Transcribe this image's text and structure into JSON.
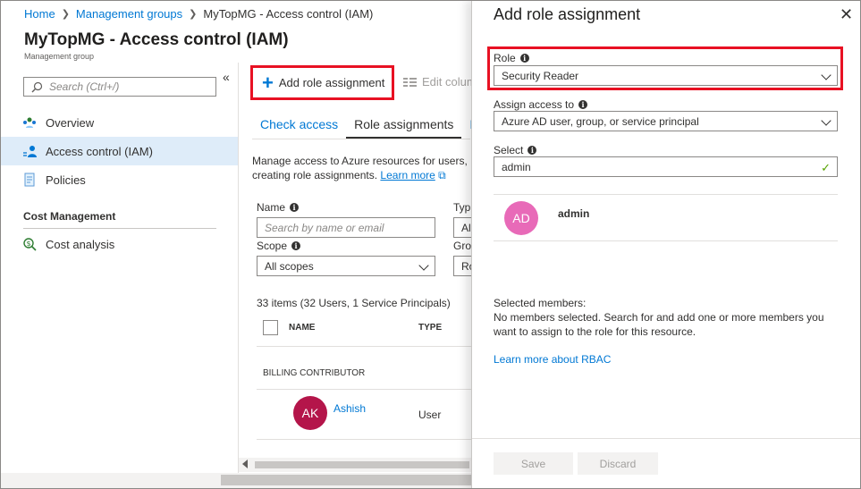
{
  "breadcrumb": {
    "items": [
      "Home",
      "Management groups",
      "MyTopMG - Access control (IAM)"
    ]
  },
  "page": {
    "title": "MyTopMG - Access control (IAM)",
    "subtitle": "Management group"
  },
  "sidebar": {
    "search_placeholder": "Search (Ctrl+/)",
    "collapse_glyph": "«",
    "items": [
      {
        "label": "Overview",
        "icon": "overview-icon"
      },
      {
        "label": "Access control (IAM)",
        "icon": "iam-icon",
        "active": true
      },
      {
        "label": "Policies",
        "icon": "policies-icon"
      }
    ],
    "section_label": "Cost Management",
    "cost_items": [
      {
        "label": "Cost analysis",
        "icon": "cost-analysis-icon"
      }
    ]
  },
  "toolbar": {
    "add_role_label": "Add role assignment",
    "edit_columns_label": "Edit colum"
  },
  "tabs": [
    "Check access",
    "Role assignments",
    "D"
  ],
  "main": {
    "description_line1": "Manage access to Azure resources for users, gr",
    "description_line2": "creating role assignments.",
    "learn_more": "Learn more",
    "name_label": "Name",
    "name_placeholder": "Search by name or email",
    "type_label": "Typ",
    "type_value": "Al",
    "scope_label": "Scope",
    "scope_value": "All scopes",
    "group_label": "Gro",
    "group_value": "Ro",
    "items_count": "33 items (32 Users, 1 Service Principals)",
    "col_name": "NAME",
    "col_type": "TYPE",
    "group_header": "BILLING CONTRIBUTOR",
    "row": {
      "initials": "AK",
      "name": "Ashish",
      "type": "User",
      "avatar_color": "#b4154a"
    }
  },
  "panel": {
    "title": "Add role assignment",
    "close_glyph": "✕",
    "role_label": "Role",
    "role_value": "Security Reader",
    "assign_label": "Assign access to",
    "assign_value": "Azure AD user, group, or service principal",
    "select_label": "Select",
    "select_value": "admin",
    "result": {
      "initials": "AD",
      "name": "admin",
      "avatar_color": "#e86ab8"
    },
    "selected_members_label": "Selected members:",
    "selected_members_text1": "No members selected. Search for and add one or more members you",
    "selected_members_text2": "want to assign to the role for this resource.",
    "learn_more_rbac": "Learn more about RBAC",
    "save_label": "Save",
    "discard_label": "Discard"
  },
  "colors": {
    "accent": "#0078d4",
    "highlight": "#e81123",
    "active_bg": "#deecf9"
  }
}
